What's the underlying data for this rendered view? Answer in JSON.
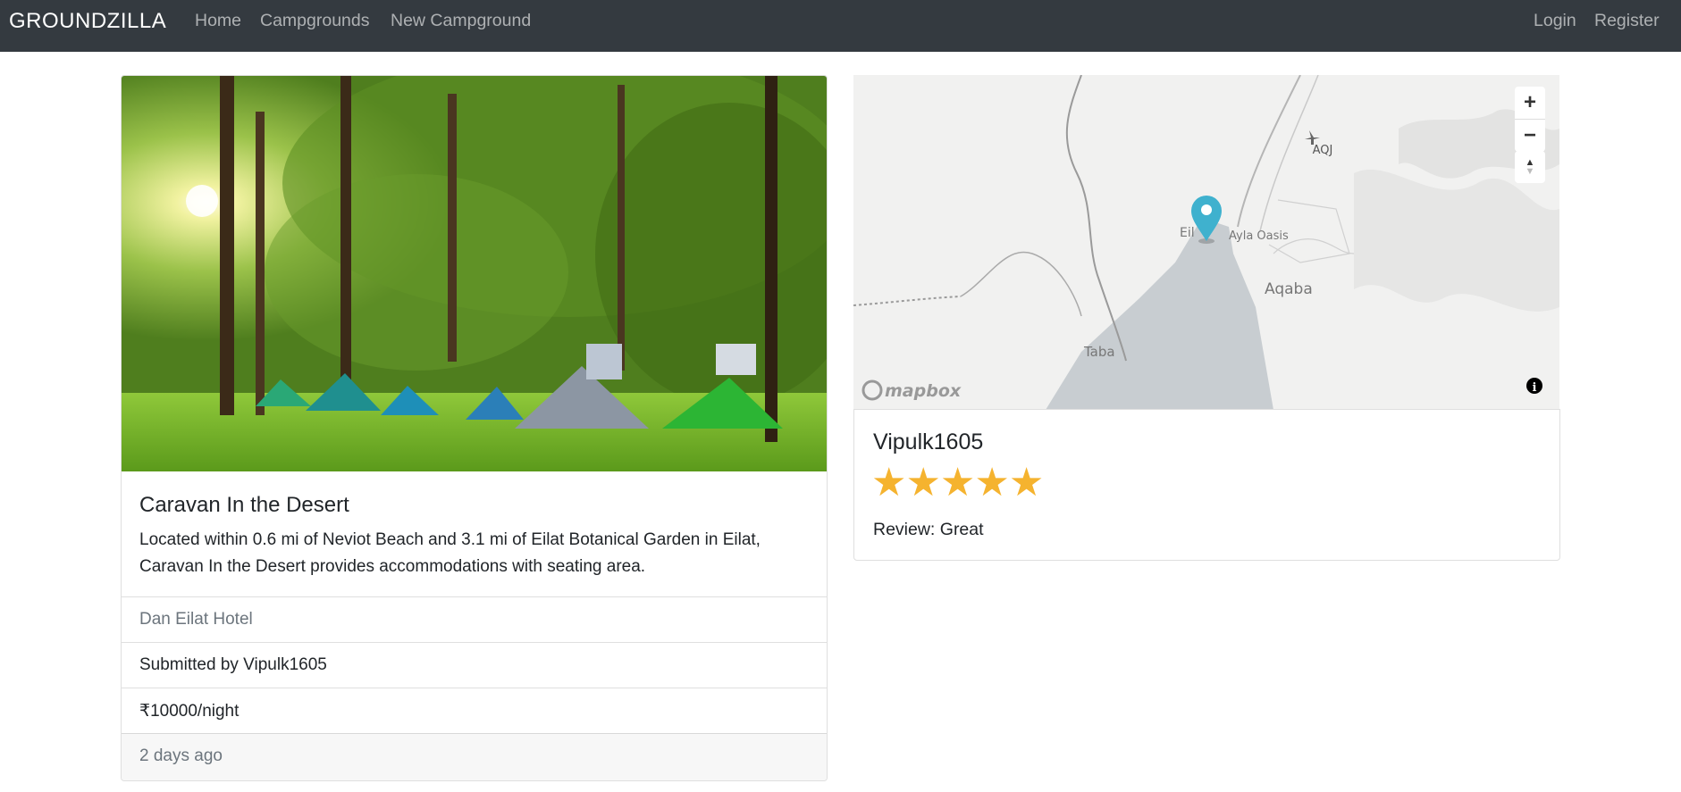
{
  "navbar": {
    "brand": "GROUNDZILLA",
    "links": [
      "Home",
      "Campgrounds",
      "New Campground"
    ],
    "auth": [
      "Login",
      "Register"
    ]
  },
  "campground": {
    "title": "Caravan In the Desert",
    "description": "Located within 0.6 mi of Neviot Beach and 3.1 mi of Eilat Botanical Garden in Eilat, Caravan In the Desert provides accommodations with seating area.",
    "location": "Dan Eilat Hotel",
    "submitted_by": "Submitted by Vipulk1605",
    "price": "₹10000/night",
    "posted": "2 days ago"
  },
  "map": {
    "labels": [
      "AQJ",
      "Eil",
      "Ayla Oasis",
      "Aqaba",
      "Taba"
    ],
    "logo": "mapbox",
    "controls": [
      "+",
      "−"
    ]
  },
  "review": {
    "author": "Vipulk1605",
    "rating": 5,
    "rating_max": 5,
    "text": "Review: Great"
  },
  "colors": {
    "navbar": "#343a40",
    "star": "#f5b32f",
    "marker": "#3fb1ce",
    "water": "#c8cdd1"
  }
}
